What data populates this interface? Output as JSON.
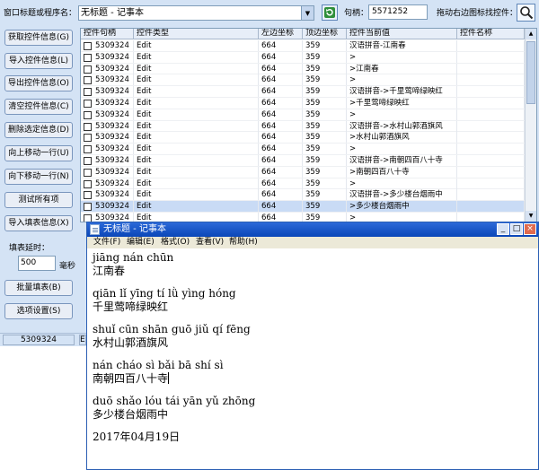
{
  "main": {
    "window_label": "窗口标题或程序名：",
    "window_value": "无标题 - 记事本",
    "hwnd_label": "句柄：",
    "hwnd_value": "5571252",
    "drag_label": "拖动右边图标找控件：",
    "buttons": [
      "获取控件信息(G)",
      "导入控件信息(L)",
      "导出控件信息(O)",
      "清空控件信息(C)",
      "删除选定信息(D)",
      "向上移动一行(U)",
      "向下移动一行(N)",
      "测试所有项",
      "导入填表信息(X)",
      "批量填表(B)",
      "选项设置(S)"
    ],
    "delay_label": "填表延时：",
    "delay_value": "500",
    "delay_unit": "毫秒",
    "status_value": "5309324",
    "status_value2": "E"
  },
  "table": {
    "headers": [
      "控件句柄",
      "控件类型",
      "左边坐标",
      "顶边坐标",
      "控件当前值",
      "控件名称"
    ],
    "rows": [
      [
        "5309324",
        "Edit",
        "664",
        "359",
        "汉语拼音-江南春",
        ""
      ],
      [
        "5309324",
        "Edit",
        "664",
        "359",
        ">",
        ""
      ],
      [
        "5309324",
        "Edit",
        "664",
        "359",
        ">江南春",
        ""
      ],
      [
        "5309324",
        "Edit",
        "664",
        "359",
        ">",
        ""
      ],
      [
        "5309324",
        "Edit",
        "664",
        "359",
        "汉语拼音->千里莺啼绿映红",
        ""
      ],
      [
        "5309324",
        "Edit",
        "664",
        "359",
        ">千里莺啼绿映红",
        ""
      ],
      [
        "5309324",
        "Edit",
        "664",
        "359",
        ">",
        ""
      ],
      [
        "5309324",
        "Edit",
        "664",
        "359",
        "汉语拼音->水村山郭酒旗风",
        ""
      ],
      [
        "5309324",
        "Edit",
        "664",
        "359",
        ">水村山郭酒旗风",
        ""
      ],
      [
        "5309324",
        "Edit",
        "664",
        "359",
        ">",
        ""
      ],
      [
        "5309324",
        "Edit",
        "664",
        "359",
        "汉语拼音->南朝四百八十寺",
        ""
      ],
      [
        "5309324",
        "Edit",
        "664",
        "359",
        ">南朝四百八十寺",
        ""
      ],
      [
        "5309324",
        "Edit",
        "664",
        "359",
        ">",
        ""
      ],
      [
        "5309324",
        "Edit",
        "664",
        "359",
        "汉语拼音->多少楼台烟雨中",
        ""
      ],
      [
        "5309324",
        "Edit",
        "664",
        "359",
        ">多少楼台烟雨中",
        ""
      ],
      [
        "5309324",
        "Edit",
        "664",
        "359",
        ">",
        ""
      ]
    ],
    "selected_row": 14
  },
  "notepad": {
    "title": "无标题 - 记事本",
    "menu": [
      "文件(F)",
      "编辑(E)",
      "格式(O)",
      "查看(V)",
      "帮助(H)"
    ],
    "lines": [
      "jiāng nán chūn",
      "江南春",
      "",
      "qiān lǐ yīng tí lǜ yìng hóng",
      "千里莺啼绿映红",
      "",
      "shuǐ cūn shān guō jiǔ qí fēng",
      "水村山郭酒旗风",
      "",
      "nán cháo sì bǎi bā shí sì",
      "南朝四百八十寺",
      "",
      "duō shǎo lóu tái yān yǔ zhōng",
      "多少楼台烟雨中",
      "",
      "2017年04月19日"
    ]
  }
}
